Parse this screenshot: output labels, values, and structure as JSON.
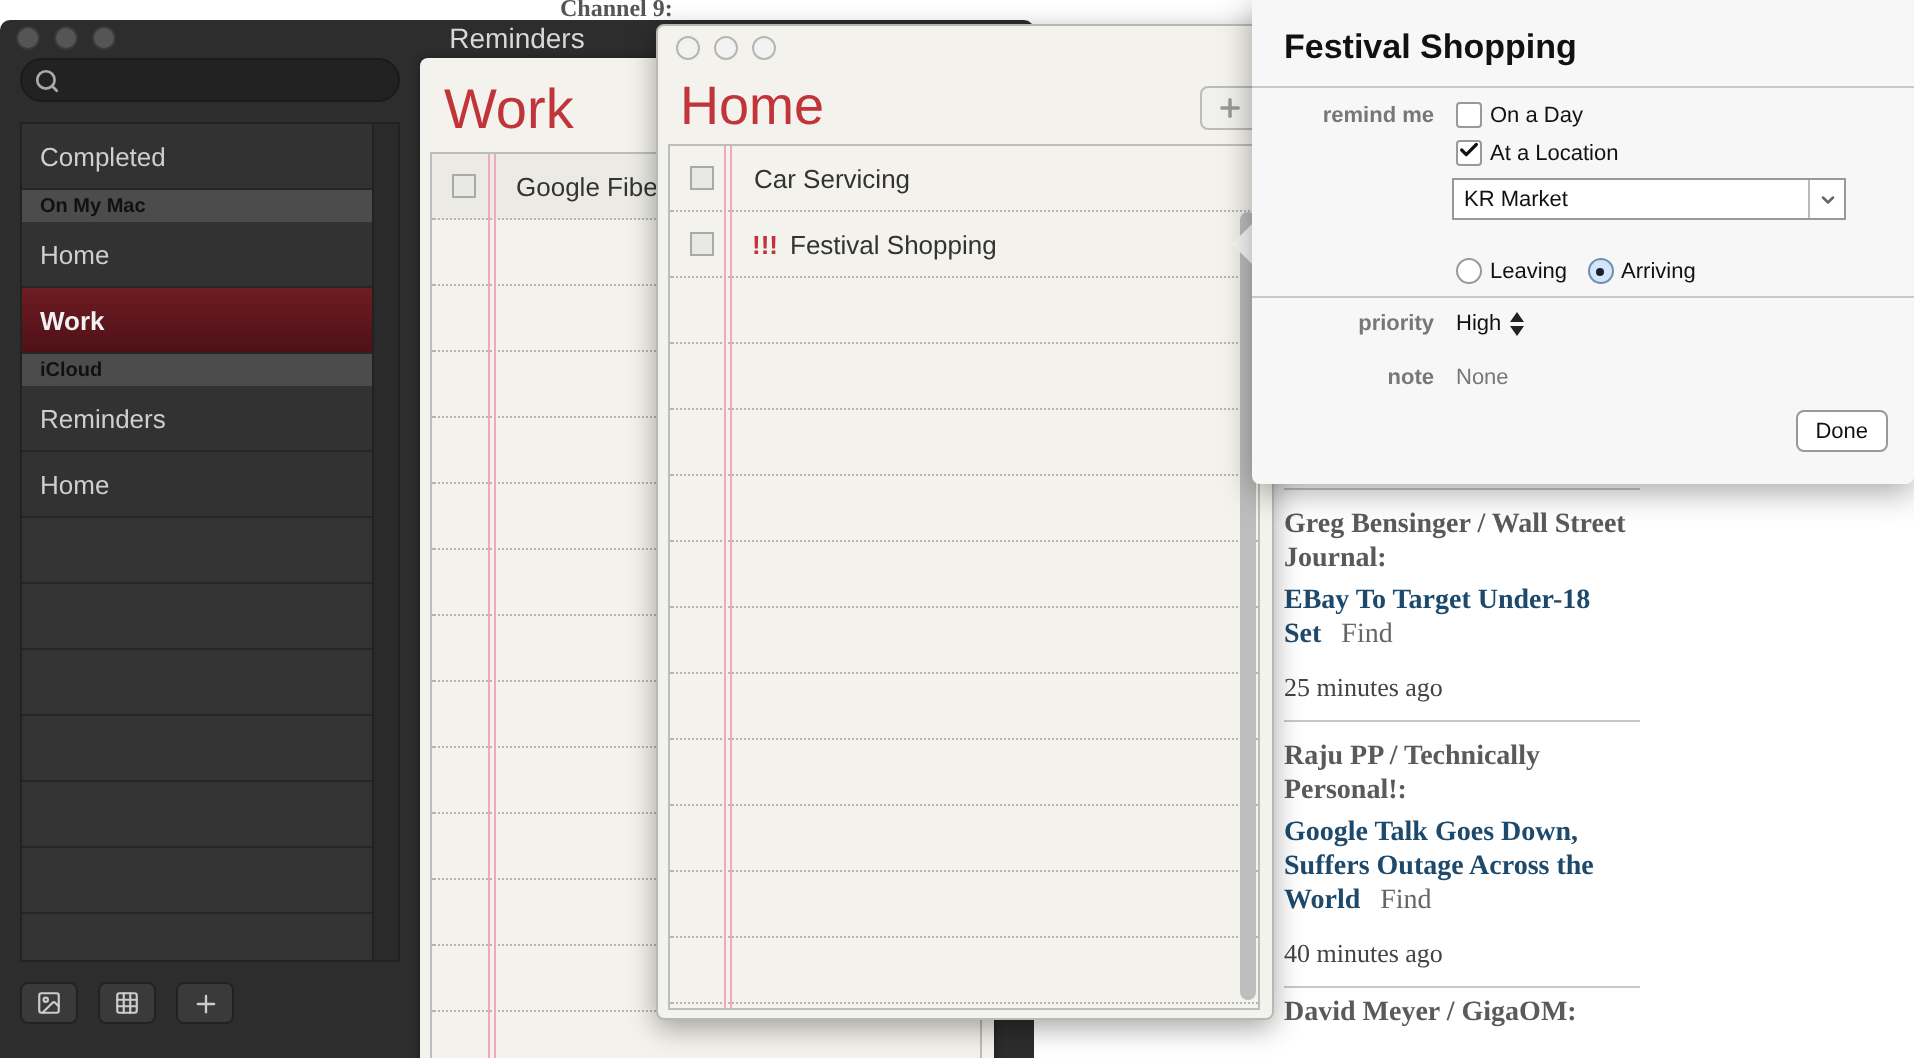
{
  "web_page": {
    "heading": "Channel 9:",
    "news": [
      {
        "author": "Greg Bensinger / Wall Street Journal:",
        "headline": "EBay To Target Under-18 Set",
        "find": "Find",
        "time": "25 minutes ago"
      },
      {
        "author": "Raju PP / Technically Personal!:",
        "headline": "Google Talk Goes Down, Suffers Outage Across the World",
        "find": "Find",
        "time": "40 minutes ago"
      }
    ],
    "next_author": "David Meyer / GigaOM:"
  },
  "reminders_window": {
    "title": "Reminders",
    "sidebar": [
      {
        "kind": "item",
        "label": "Completed",
        "selected": false
      },
      {
        "kind": "header",
        "label": "On My Mac"
      },
      {
        "kind": "item",
        "label": "Home",
        "selected": false
      },
      {
        "kind": "item",
        "label": "Work",
        "selected": true
      },
      {
        "kind": "header",
        "label": "iCloud"
      },
      {
        "kind": "item",
        "label": "Reminders",
        "selected": false
      },
      {
        "kind": "item",
        "label": "Home",
        "selected": false
      }
    ],
    "list_title": "Work",
    "items": [
      {
        "title": "Google Fibe",
        "checked": false
      }
    ]
  },
  "home_window": {
    "title": "Home",
    "items": [
      {
        "title": "Car Servicing",
        "checked": false
      },
      {
        "priority_mark": "!!!",
        "title": "Festival Shopping",
        "checked": false
      }
    ]
  },
  "popover": {
    "title": "Festival Shopping",
    "remind_label": "remind me",
    "options": [
      {
        "label": "On a Day",
        "checked": false
      },
      {
        "label": "At a Location",
        "checked": true
      }
    ],
    "location": "KR Market",
    "triggers": [
      {
        "label": "Leaving",
        "selected": false
      },
      {
        "label": "Arriving",
        "selected": true
      }
    ],
    "priority_label": "priority",
    "priority": "High",
    "note_label": "note",
    "note": "None",
    "done": "Done"
  }
}
